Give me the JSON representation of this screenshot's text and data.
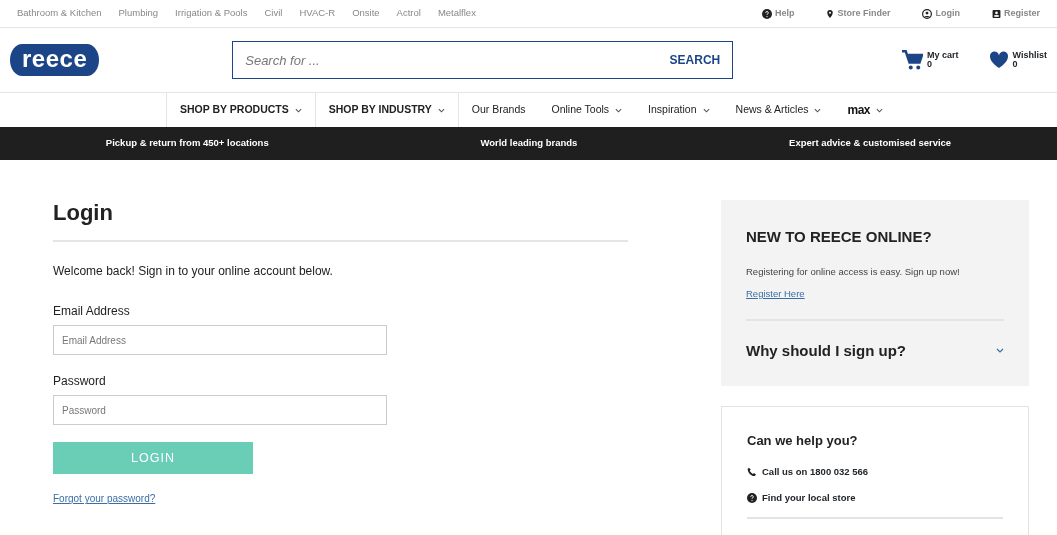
{
  "top_links": [
    "Bathroom & Kitchen",
    "Plumbing",
    "Irrigation & Pools",
    "Civil",
    "HVAC-R",
    "Onsite",
    "Actrol",
    "Metalflex"
  ],
  "utility_links": [
    {
      "kind": "help",
      "label": "Help"
    },
    {
      "kind": "pin",
      "label": "Store Finder"
    },
    {
      "kind": "user",
      "label": "Login"
    },
    {
      "kind": "register",
      "label": "Register"
    }
  ],
  "logo": "reece",
  "search": {
    "placeholder": "Search for ...",
    "button": "SEARCH"
  },
  "cart": {
    "label": "My cart",
    "count": "0"
  },
  "wishlist": {
    "label": "Wishlist",
    "count": "0"
  },
  "nav": [
    {
      "kind": "section",
      "label": "SHOP BY PRODUCTS",
      "caret": true
    },
    {
      "kind": "section",
      "label": "SHOP BY INDUSTRY",
      "caret": true
    },
    {
      "kind": "link",
      "label": "Our Brands",
      "caret": false
    },
    {
      "kind": "link",
      "label": "Online Tools",
      "caret": true
    },
    {
      "kind": "link",
      "label": "Inspiration",
      "caret": true
    },
    {
      "kind": "link",
      "label": "News & Articles",
      "caret": true
    },
    {
      "kind": "brand",
      "label": "max",
      "caret": true
    }
  ],
  "promo_bar": [
    "Pickup & return from 450+ locations",
    "World leading brands",
    "Expert advice & customised service"
  ],
  "login": {
    "title": "Login",
    "intro": "Welcome back! Sign in to your online account below.",
    "fields": [
      {
        "label": "Email Address",
        "placeholder": "Email Address"
      },
      {
        "label": "Password",
        "placeholder": "Password"
      }
    ],
    "button": "LOGIN",
    "forgot": "Forgot your password?"
  },
  "register_panel": {
    "title": "NEW TO REECE ONLINE?",
    "text": "Registering for online access is easy. Sign up now!",
    "link": "Register Here",
    "accordion": {
      "label": "Why should I sign up?",
      "expanded": false
    }
  },
  "help_panel": {
    "title": "Can we help you?",
    "items": [
      {
        "kind": "phone",
        "label": "Call us on 1800 032 566"
      },
      {
        "kind": "help",
        "label": "Find your local store"
      }
    ]
  }
}
